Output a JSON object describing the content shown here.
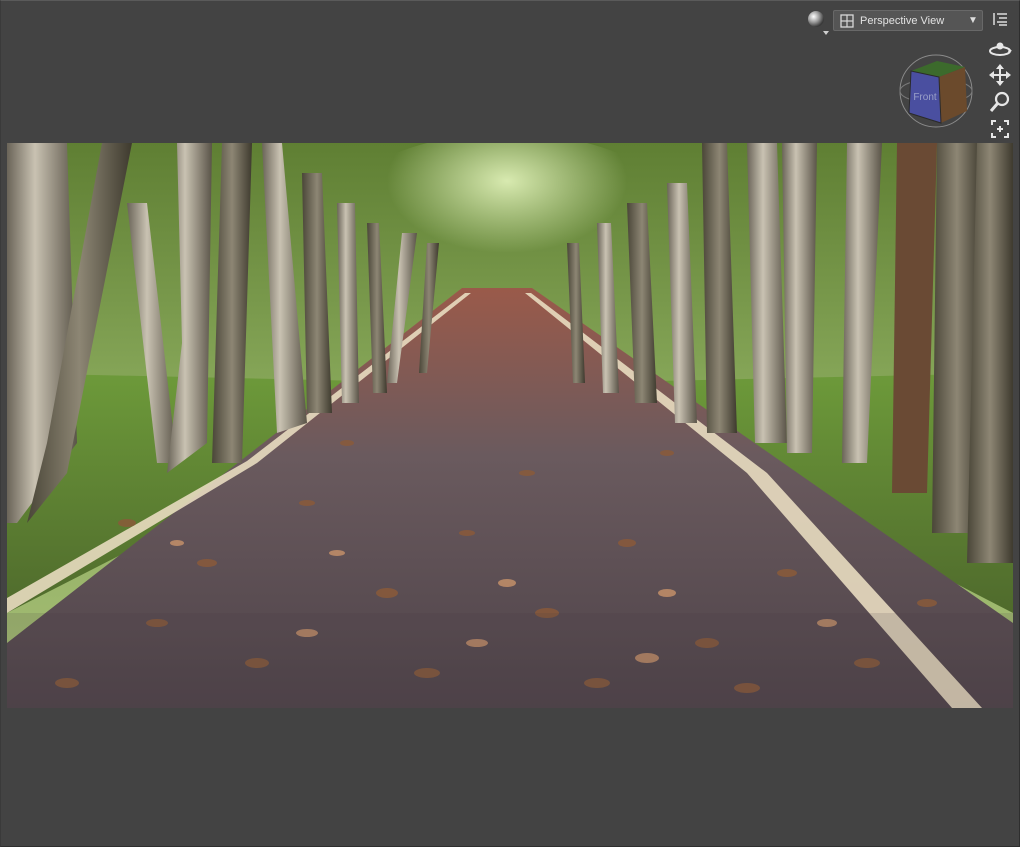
{
  "toolbar": {
    "shading_icon": "sphere-shading-icon",
    "view_select": {
      "selected": "Perspective View",
      "icon": "viewport-grid-icon"
    },
    "options_icon": "viewport-options-icon"
  },
  "nav_cube": {
    "face_label": "Front",
    "colors": {
      "front": "#4a4fa0",
      "top": "#3c6a2c",
      "side": "#6b4a2c"
    }
  },
  "side_tools": [
    {
      "name": "orbit-icon"
    },
    {
      "name": "pan-icon"
    },
    {
      "name": "zoom-icon"
    },
    {
      "name": "frame-icon"
    },
    {
      "name": "reset-view-icon"
    }
  ],
  "viewport": {
    "content": "photo-backdrop"
  },
  "colors": {
    "background": "#434343",
    "toolbar": "#555555",
    "text": "#e2e2e2"
  }
}
